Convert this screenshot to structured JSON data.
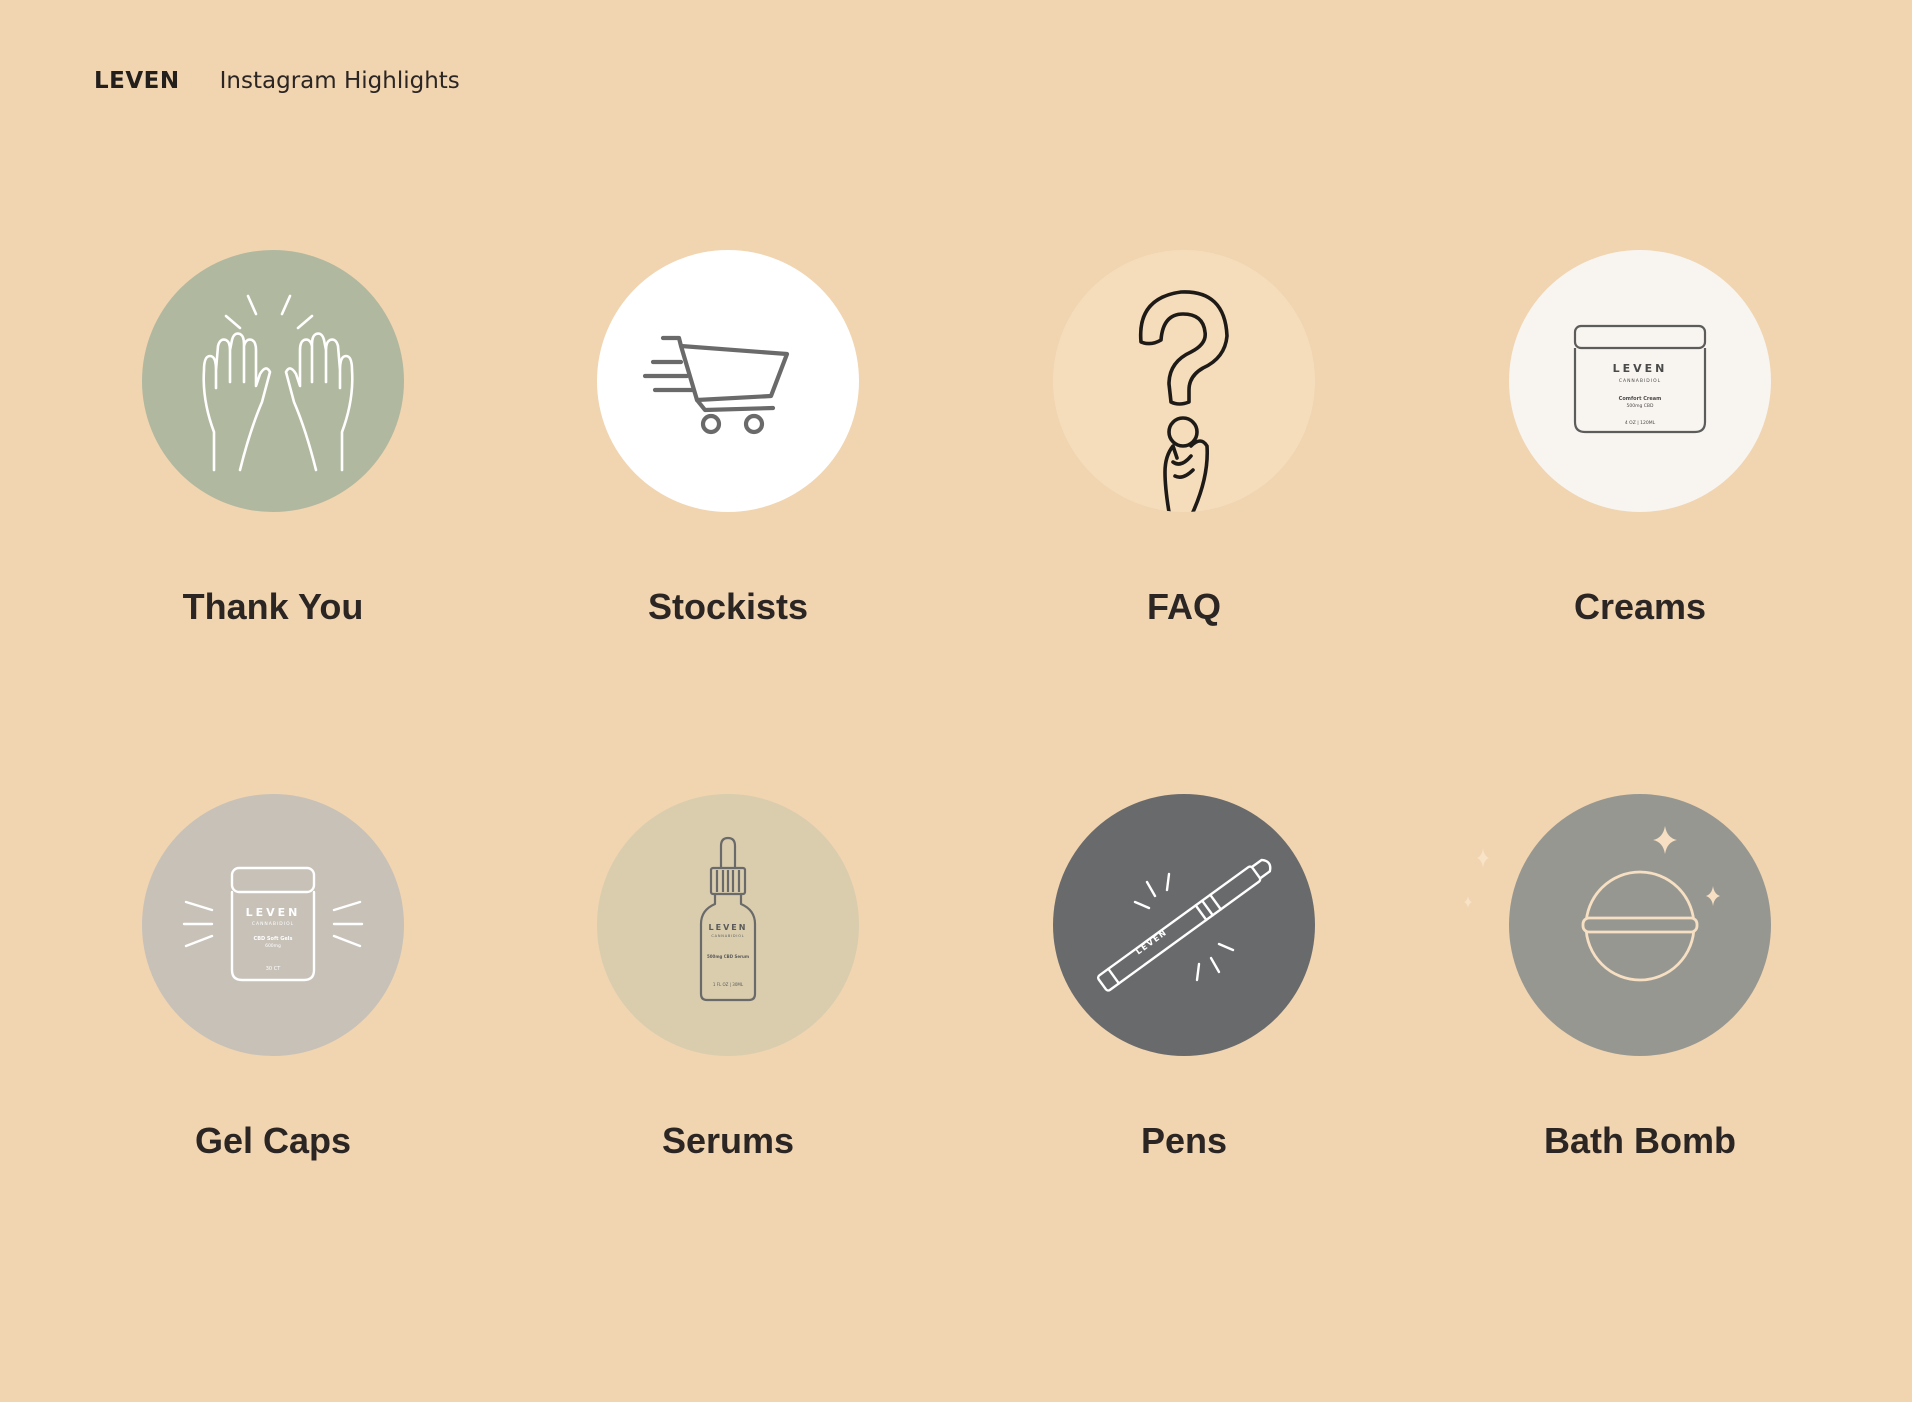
{
  "header": {
    "brand": "LEVEN",
    "subtitle": "Instagram Highlights"
  },
  "highlights": [
    {
      "label": "Thank You",
      "icon": "raised-hands-icon",
      "bg": "#B0B89F"
    },
    {
      "label": "Stockists",
      "icon": "shopping-cart-icon",
      "bg": "#FFFFFF"
    },
    {
      "label": "FAQ",
      "icon": "question-hand-icon",
      "bg": "#F5DDBB"
    },
    {
      "label": "Creams",
      "icon": "cream-jar-icon",
      "bg": "#F8F4EF"
    },
    {
      "label": "Gel Caps",
      "icon": "gel-caps-jar-icon",
      "bg": "#C7C1B8"
    },
    {
      "label": "Serums",
      "icon": "serum-bottle-icon",
      "bg": "#D9CDAE"
    },
    {
      "label": "Pens",
      "icon": "vape-pen-icon",
      "bg": "#696A6C"
    },
    {
      "label": "Bath Bomb",
      "icon": "bath-bomb-icon",
      "bg": "#979791"
    }
  ],
  "product_text": {
    "brand": "LEVEN",
    "cream_line1": "CANNABIDIOL",
    "cream_name": "Comfort Cream",
    "cream_mg": "500mg CBD",
    "cream_size": "4 OZ | 120ML",
    "caps_line1": "CANNABIDIOL",
    "caps_name": "CBD Soft Gels",
    "caps_mg": "600mg",
    "caps_count": "30 CT",
    "serum_line1": "CANNABIDIOL",
    "serum_name": "500mg CBD Serum",
    "serum_size": "1 FL OZ | 30ML"
  }
}
